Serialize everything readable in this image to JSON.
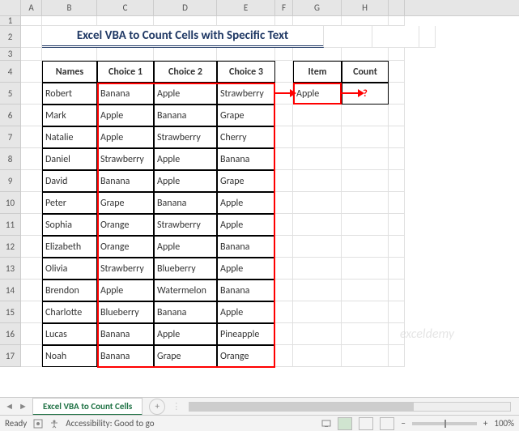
{
  "columns": [
    "A",
    "B",
    "C",
    "D",
    "E",
    "F",
    "G",
    "H",
    ""
  ],
  "title": "Excel VBA to Count Cells with Specific Text",
  "headers": {
    "names": "Names",
    "c1": "Choice 1",
    "c2": "Choice 2",
    "c3": "Choice 3"
  },
  "side": {
    "item": "Item",
    "count": "Count",
    "item_value": "Apple",
    "count_value": "?"
  },
  "rows": [
    {
      "n": "Robert",
      "c1": "Banana",
      "c2": "Apple",
      "c3": "Strawberry"
    },
    {
      "n": "Mark",
      "c1": "Apple",
      "c2": "Banana",
      "c3": "Grape"
    },
    {
      "n": "Natalie",
      "c1": "Apple",
      "c2": "Strawberry",
      "c3": "Cherry"
    },
    {
      "n": "Daniel",
      "c1": "Strawberry",
      "c2": "Apple",
      "c3": "Banana"
    },
    {
      "n": "David",
      "c1": "Banana",
      "c2": "Apple",
      "c3": "Grape"
    },
    {
      "n": "Peter",
      "c1": "Grape",
      "c2": "Banana",
      "c3": "Apple"
    },
    {
      "n": "Sophia",
      "c1": "Orange",
      "c2": "Strawberry",
      "c3": "Apple"
    },
    {
      "n": "Elizabeth",
      "c1": "Orange",
      "c2": "Apple",
      "c3": "Banana"
    },
    {
      "n": "Olivia",
      "c1": "Strawberry",
      "c2": "Blueberry",
      "c3": "Apple"
    },
    {
      "n": "Brendon",
      "c1": "Apple",
      "c2": "Watermelon",
      "c3": "Banana"
    },
    {
      "n": "Charlotte",
      "c1": "Blueberry",
      "c2": "Banana",
      "c3": "Apple"
    },
    {
      "n": "Lucas",
      "c1": "Banana",
      "c2": "Apple",
      "c3": "Pineapple"
    },
    {
      "n": "Noah",
      "c1": "Banana",
      "c2": "Grape",
      "c3": "Orange"
    }
  ],
  "tab": "Excel VBA to Count Cells",
  "status": {
    "ready": "Ready",
    "access": "Accessibility: Good to go",
    "zoom": "100%"
  },
  "watermark": "exceldemy",
  "chart_data": {
    "type": "table",
    "title": "Excel VBA to Count Cells with Specific Text",
    "columns": [
      "Names",
      "Choice 1",
      "Choice 2",
      "Choice 3"
    ],
    "data": [
      [
        "Robert",
        "Banana",
        "Apple",
        "Strawberry"
      ],
      [
        "Mark",
        "Apple",
        "Banana",
        "Grape"
      ],
      [
        "Natalie",
        "Apple",
        "Strawberry",
        "Cherry"
      ],
      [
        "Daniel",
        "Strawberry",
        "Apple",
        "Banana"
      ],
      [
        "David",
        "Banana",
        "Apple",
        "Grape"
      ],
      [
        "Peter",
        "Grape",
        "Banana",
        "Apple"
      ],
      [
        "Sophia",
        "Orange",
        "Strawberry",
        "Apple"
      ],
      [
        "Elizabeth",
        "Orange",
        "Apple",
        "Banana"
      ],
      [
        "Olivia",
        "Strawberry",
        "Blueberry",
        "Apple"
      ],
      [
        "Brendon",
        "Apple",
        "Watermelon",
        "Banana"
      ],
      [
        "Charlotte",
        "Blueberry",
        "Banana",
        "Apple"
      ],
      [
        "Lucas",
        "Banana",
        "Apple",
        "Pineapple"
      ],
      [
        "Noah",
        "Banana",
        "Grape",
        "Orange"
      ]
    ],
    "lookup": {
      "item": "Apple",
      "count": "?"
    }
  }
}
